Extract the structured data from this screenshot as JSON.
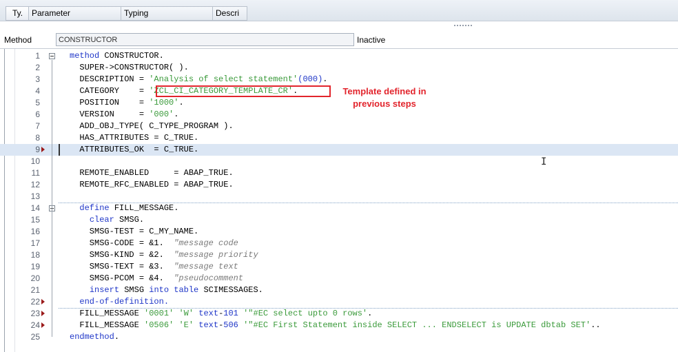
{
  "params_header": {
    "columns": [
      "Ty.",
      "Parameter",
      "Typing",
      "Descri"
    ]
  },
  "method": {
    "label": "Method",
    "name": "CONSTRUCTOR",
    "status": "Inactive"
  },
  "annotation": {
    "line1": "Template defined in",
    "line2": "previous steps"
  },
  "code_lines": [
    {
      "n": "1",
      "segments": [
        [
          "k",
          "method"
        ],
        [
          "t",
          " CONSTRUCTOR."
        ]
      ]
    },
    {
      "n": "2",
      "segments": [
        [
          "t",
          "  SUPER->CONSTRUCTOR( )."
        ]
      ]
    },
    {
      "n": "3",
      "segments": [
        [
          "t",
          "  DESCRIPTION = "
        ],
        [
          "s",
          "'Analysis of select statement'"
        ],
        [
          "n",
          "(000)"
        ],
        [
          "t",
          "."
        ]
      ]
    },
    {
      "n": "4",
      "segments": [
        [
          "t",
          "  CATEGORY    = "
        ],
        [
          "s",
          "'ZCL_CI_CATEGORY_TEMPLATE_CR'"
        ],
        [
          "t",
          "."
        ]
      ]
    },
    {
      "n": "5",
      "segments": [
        [
          "t",
          "  POSITION    = "
        ],
        [
          "s",
          "'1000'"
        ],
        [
          "t",
          "."
        ]
      ]
    },
    {
      "n": "6",
      "segments": [
        [
          "t",
          "  VERSION     = "
        ],
        [
          "s",
          "'000'"
        ],
        [
          "t",
          "."
        ]
      ]
    },
    {
      "n": "7",
      "segments": [
        [
          "t",
          "  ADD_OBJ_TYPE( C_TYPE_PROGRAM )."
        ]
      ]
    },
    {
      "n": "8",
      "segments": [
        [
          "t",
          "  HAS_ATTRIBUTES = C_TRUE."
        ]
      ]
    },
    {
      "n": "9",
      "segments": [
        [
          "t",
          "  ATTRIBUTES_OK  = C_TRUE."
        ]
      ]
    },
    {
      "n": "10",
      "segments": []
    },
    {
      "n": "11",
      "segments": [
        [
          "t",
          "  REMOTE_ENABLED     = ABAP_TRUE."
        ]
      ]
    },
    {
      "n": "12",
      "segments": [
        [
          "t",
          "  REMOTE_RFC_ENABLED = ABAP_TRUE."
        ]
      ]
    },
    {
      "n": "13",
      "segments": []
    },
    {
      "n": "14",
      "segments": [
        [
          "t",
          "  "
        ],
        [
          "k",
          "define"
        ],
        [
          "t",
          " FILL_MESSAGE."
        ]
      ]
    },
    {
      "n": "15",
      "segments": [
        [
          "t",
          "    "
        ],
        [
          "k",
          "clear"
        ],
        [
          "t",
          " SMSG."
        ]
      ]
    },
    {
      "n": "16",
      "segments": [
        [
          "t",
          "    SMSG-TEST = C_MY_NAME."
        ]
      ]
    },
    {
      "n": "17",
      "segments": [
        [
          "t",
          "    SMSG-CODE = &1.  "
        ],
        [
          "c",
          "\"message code"
        ]
      ]
    },
    {
      "n": "18",
      "segments": [
        [
          "t",
          "    SMSG-KIND = &2.  "
        ],
        [
          "c",
          "\"message priority"
        ]
      ]
    },
    {
      "n": "19",
      "segments": [
        [
          "t",
          "    SMSG-TEXT = &3.  "
        ],
        [
          "c",
          "\"message text"
        ]
      ]
    },
    {
      "n": "20",
      "segments": [
        [
          "t",
          "    SMSG-PCOM = &4.  "
        ],
        [
          "c",
          "\"pseudocomment"
        ]
      ]
    },
    {
      "n": "21",
      "segments": [
        [
          "t",
          "    "
        ],
        [
          "k",
          "insert"
        ],
        [
          "t",
          " SMSG "
        ],
        [
          "k",
          "into table"
        ],
        [
          "t",
          " SCIMESSAGES."
        ]
      ]
    },
    {
      "n": "22",
      "segments": [
        [
          "t",
          "  "
        ],
        [
          "k",
          "end-of-definition."
        ]
      ]
    },
    {
      "n": "23",
      "segments": [
        [
          "t",
          "  FILL_MESSAGE "
        ],
        [
          "s",
          "'0001'"
        ],
        [
          "t",
          " "
        ],
        [
          "s",
          "'W'"
        ],
        [
          "t",
          " "
        ],
        [
          "k",
          "text"
        ],
        [
          "t",
          "-"
        ],
        [
          "n",
          "101"
        ],
        [
          "t",
          " "
        ],
        [
          "s",
          "'\"#EC select upto 0 rows'"
        ],
        [
          "t",
          "."
        ]
      ]
    },
    {
      "n": "24",
      "segments": [
        [
          "t",
          "  FILL_MESSAGE "
        ],
        [
          "s",
          "'0506'"
        ],
        [
          "t",
          " "
        ],
        [
          "s",
          "'E'"
        ],
        [
          "t",
          " "
        ],
        [
          "k",
          "text"
        ],
        [
          "t",
          "-"
        ],
        [
          "n",
          "506"
        ],
        [
          "t",
          " "
        ],
        [
          "s",
          "'\"#EC First Statement inside SELECT ... ENDSELECT is UPDATE dbtab SET'"
        ],
        [
          "t",
          ".."
        ]
      ]
    },
    {
      "n": "25",
      "segments": [
        [
          "k",
          "endmethod"
        ],
        [
          "t",
          "."
        ]
      ]
    }
  ],
  "colors": {
    "keyword": "#1f36c8",
    "string": "#3a9a3a",
    "comment": "#7a7a7a",
    "annotation": "#e2242c",
    "active_line": "#dbe6f4"
  }
}
